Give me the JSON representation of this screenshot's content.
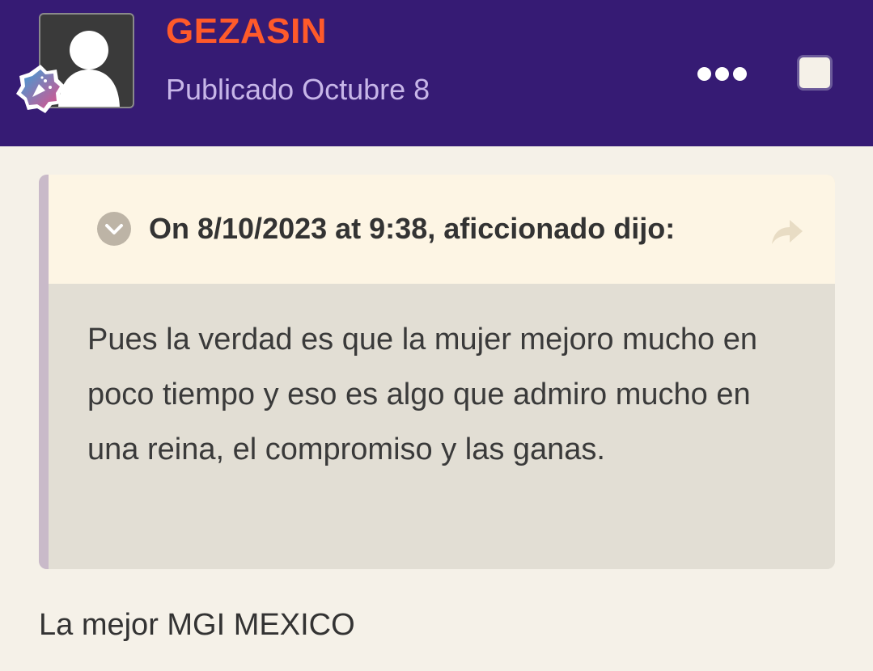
{
  "post": {
    "author": "GEZASIN",
    "posted_label": "Publicado Octubre 8",
    "avatar_icon": "default-user-silhouette-icon",
    "badge_icon": "celebration-badge-icon",
    "menu_icon": "more-options-icon",
    "select_icon": "checkbox-icon"
  },
  "quote": {
    "citation": "On 8/10/2023 at 9:38, aficcionado dijo:",
    "expand_icon": "chevron-down-icon",
    "share_icon": "share-arrow-icon",
    "body": "Pues la verdad es que la mujer mejoro mucho en poco tiempo y eso es algo que admiro mucho en una reina, el compromiso y las ganas."
  },
  "reply_text": "La mejor MGI MEXICO",
  "colors": {
    "header_bg": "#361b74",
    "author": "#ff5a2a",
    "posted": "#c7b6e8",
    "page_bg": "#f5f1e8",
    "quote_head_bg": "#fdf5e4",
    "quote_body_bg": "#e2ded4"
  }
}
